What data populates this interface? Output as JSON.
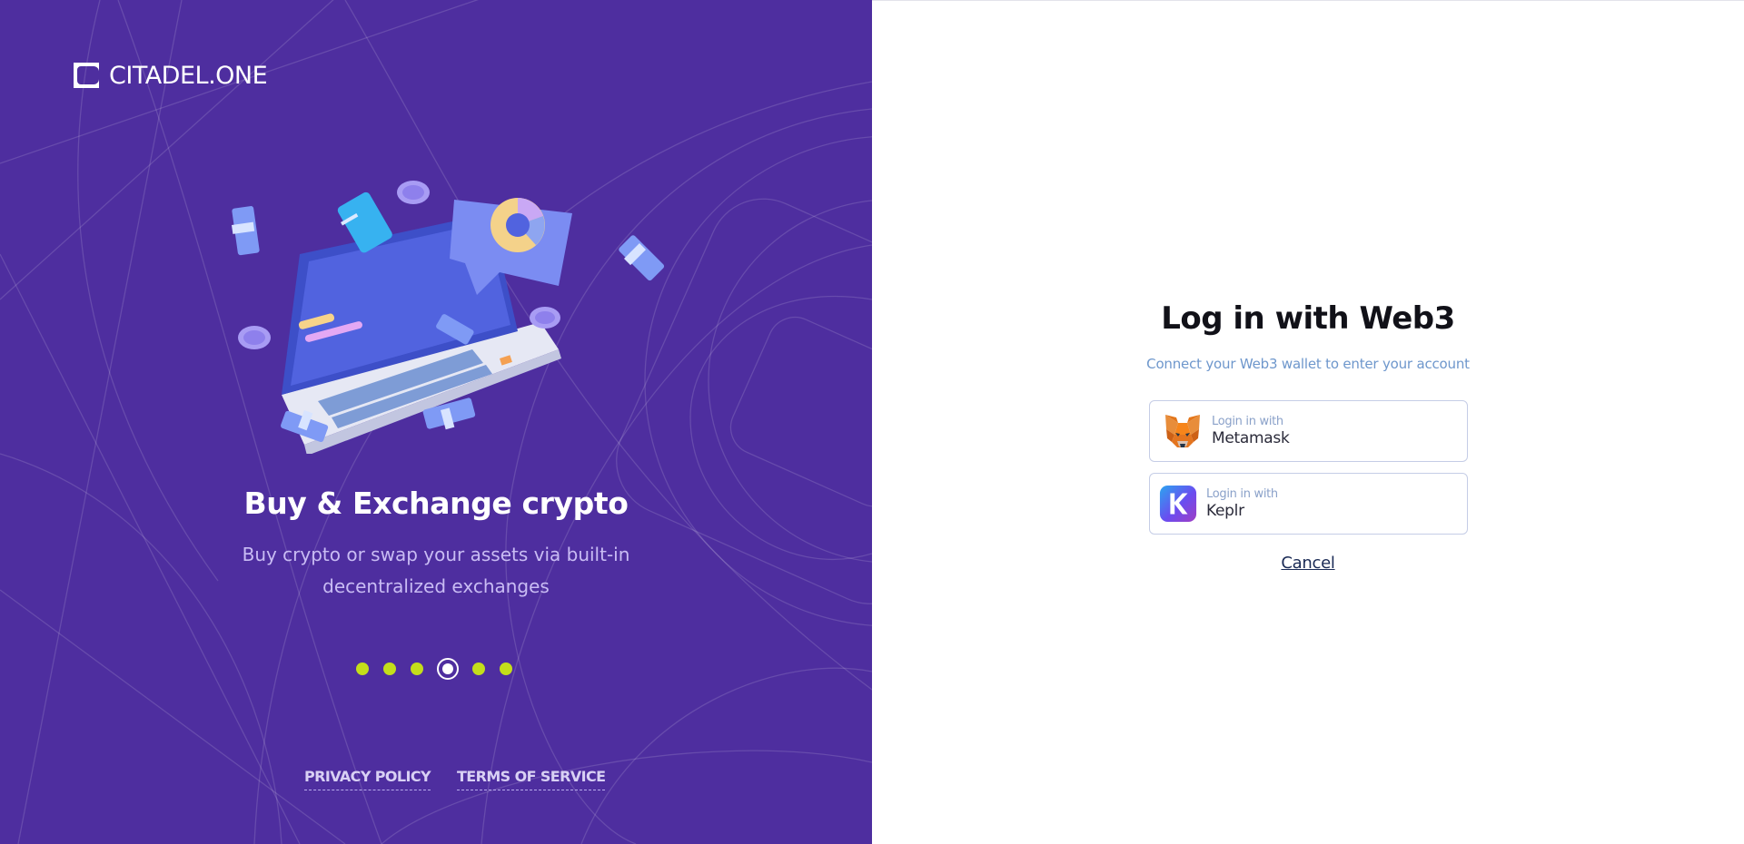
{
  "brand": {
    "logo_text": "CITADEL.ONE"
  },
  "slide": {
    "title": "Buy & Exchange crypto",
    "description": "Buy crypto or swap your assets via built-in decentralized exchanges",
    "count": 6,
    "active_index": 3
  },
  "footer": {
    "privacy": "PRIVACY POLICY",
    "terms": "TERMS OF SERVICE"
  },
  "login": {
    "title": "Log in with Web3",
    "subtitle": "Connect your Web3 wallet to enter your account",
    "wallets": [
      {
        "prefix": "Login in with",
        "name": "Metamask",
        "icon": "metamask-fox-icon"
      },
      {
        "prefix": "Login in with",
        "name": "Keplr",
        "icon": "keplr-k-icon"
      }
    ],
    "cancel": "Cancel"
  },
  "colors": {
    "left_panel": "#4e2e9f",
    "dot": "#c4de1a",
    "subtitle": "#6e97cc",
    "button_border": "#c5cde6"
  }
}
